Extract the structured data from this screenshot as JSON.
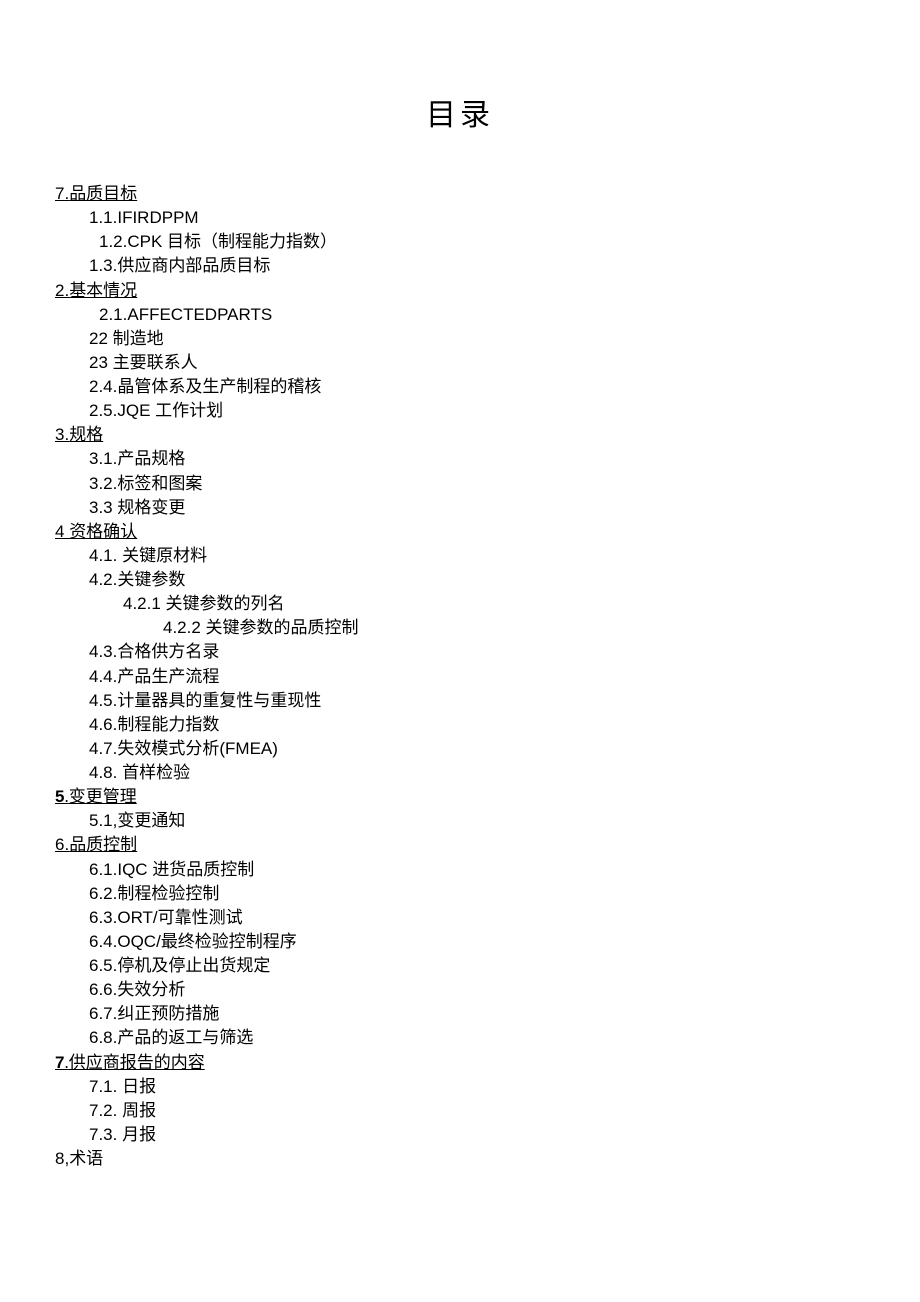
{
  "title": "目录",
  "items": [
    {
      "cls": "l1",
      "spans": [
        {
          "t": "7.",
          "c": "num ul"
        },
        {
          "t": "品质目标",
          "c": "zh-ital ul"
        }
      ]
    },
    {
      "cls": "l2",
      "spans": [
        {
          "t": "1.1.IFIRDPPM",
          "c": "num"
        }
      ]
    },
    {
      "cls": "l2b",
      "spans": [
        {
          "t": "1.2.CPK ",
          "c": "num"
        },
        {
          "t": "目标（制程能力指数）",
          "c": "zh"
        }
      ]
    },
    {
      "cls": "l2",
      "spans": [
        {
          "t": "1.3.",
          "c": "num"
        },
        {
          "t": "供应商内部品质目标",
          "c": "zh"
        }
      ]
    },
    {
      "cls": "l1",
      "spans": [
        {
          "t": "2.",
          "c": "num ul"
        },
        {
          "t": "基本情况",
          "c": "zh-ital ul"
        }
      ]
    },
    {
      "cls": "l2b",
      "spans": [
        {
          "t": "2.1.AFFECTEDPARTS",
          "c": "num"
        }
      ]
    },
    {
      "cls": "l2",
      "spans": [
        {
          "t": "22 ",
          "c": "num"
        },
        {
          "t": "制造地",
          "c": "zh"
        }
      ]
    },
    {
      "cls": "l2",
      "spans": [
        {
          "t": "23 ",
          "c": "num"
        },
        {
          "t": "主要联系人",
          "c": "zh"
        }
      ]
    },
    {
      "cls": "l2",
      "spans": [
        {
          "t": "2.4.",
          "c": "num"
        },
        {
          "t": "晶管体系及生产制程的稽核",
          "c": "zh"
        }
      ]
    },
    {
      "cls": "l2",
      "spans": [
        {
          "t": "2.5.JQE ",
          "c": "num"
        },
        {
          "t": "工作计划",
          "c": "zh"
        }
      ]
    },
    {
      "cls": "l1",
      "spans": [
        {
          "t": "3.",
          "c": "num ul"
        },
        {
          "t": "规格",
          "c": "zh-ital ul"
        }
      ]
    },
    {
      "cls": "l2",
      "spans": [
        {
          "t": "3.1.",
          "c": "num"
        },
        {
          "t": "产品规格",
          "c": "zh"
        }
      ]
    },
    {
      "cls": "l2",
      "spans": [
        {
          "t": "3.2.",
          "c": "num"
        },
        {
          "t": "标签和图案",
          "c": "zh"
        }
      ]
    },
    {
      "cls": "l2",
      "spans": [
        {
          "t": "3.3 ",
          "c": "num"
        },
        {
          "t": "规格变更",
          "c": "zh"
        }
      ]
    },
    {
      "cls": "l1",
      "spans": [
        {
          "t": "4 ",
          "c": "num ul"
        },
        {
          "t": "资格确认",
          "c": "zh-ital ul"
        }
      ]
    },
    {
      "cls": "l2",
      "spans": [
        {
          "t": "4.1. ",
          "c": "num"
        },
        {
          "t": "关键原材料",
          "c": "zh"
        }
      ]
    },
    {
      "cls": "l2",
      "spans": [
        {
          "t": "4.2.",
          "c": "num"
        },
        {
          "t": "关键参数",
          "c": "zh"
        }
      ]
    },
    {
      "cls": "l3",
      "spans": [
        {
          "t": "4.2.1 ",
          "c": "num"
        },
        {
          "t": "关键参数的列名",
          "c": "zh"
        }
      ]
    },
    {
      "cls": "l4",
      "spans": [
        {
          "t": "4.2.2 ",
          "c": "num"
        },
        {
          "t": "关键参数的品质控制",
          "c": "zh"
        }
      ]
    },
    {
      "cls": "l2",
      "spans": [
        {
          "t": "4.3.",
          "c": "num"
        },
        {
          "t": "合格供方名录",
          "c": "zh"
        }
      ]
    },
    {
      "cls": "l2",
      "spans": [
        {
          "t": "4.4.",
          "c": "num"
        },
        {
          "t": "产品生产流程",
          "c": "zh"
        }
      ]
    },
    {
      "cls": "l2",
      "spans": [
        {
          "t": "4.5.",
          "c": "num"
        },
        {
          "t": "计量器具的重复性与重现性",
          "c": "zh"
        }
      ]
    },
    {
      "cls": "l2",
      "spans": [
        {
          "t": "4.6.",
          "c": "num"
        },
        {
          "t": "制程能力指数",
          "c": "zh"
        }
      ]
    },
    {
      "cls": "l2",
      "spans": [
        {
          "t": "4.7.",
          "c": "num"
        },
        {
          "t": "失效模式分析",
          "c": "zh"
        },
        {
          "t": "(FMEA)",
          "c": "num"
        }
      ]
    },
    {
      "cls": "l2",
      "spans": [
        {
          "t": "4.8. ",
          "c": "num"
        },
        {
          "t": "首样检验",
          "c": "zh"
        }
      ]
    },
    {
      "cls": "l1",
      "spans": [
        {
          "t": "5",
          "c": "num bold ul"
        },
        {
          "t": ".",
          "c": "zh-ital ul"
        },
        {
          "t": "变更管理",
          "c": "zh-ital ul"
        }
      ]
    },
    {
      "cls": "l2",
      "spans": [
        {
          "t": "5.1,",
          "c": "num"
        },
        {
          "t": "变更通知",
          "c": "zh"
        }
      ]
    },
    {
      "cls": "l1",
      "spans": [
        {
          "t": "6.",
          "c": "num ul"
        },
        {
          "t": "品质控制",
          "c": "zh-ital ul"
        }
      ]
    },
    {
      "cls": "l2",
      "spans": [
        {
          "t": "6.1.IQC ",
          "c": "num"
        },
        {
          "t": "进货品质控制",
          "c": "zh"
        }
      ]
    },
    {
      "cls": "l2",
      "spans": [
        {
          "t": "6.2.",
          "c": "num"
        },
        {
          "t": "制程检验控制",
          "c": "zh"
        }
      ]
    },
    {
      "cls": "l2",
      "spans": [
        {
          "t": "6.3.ORT/",
          "c": "num"
        },
        {
          "t": "可靠性测试",
          "c": "zh"
        }
      ]
    },
    {
      "cls": "l2",
      "spans": [
        {
          "t": "6.4.OQC/",
          "c": "num"
        },
        {
          "t": "最终检验控制程序",
          "c": "zh"
        }
      ]
    },
    {
      "cls": "l2",
      "spans": [
        {
          "t": "6.5.",
          "c": "num"
        },
        {
          "t": "停机及停止出货规定",
          "c": "zh"
        }
      ]
    },
    {
      "cls": "l2",
      "spans": [
        {
          "t": "6.6.",
          "c": "num"
        },
        {
          "t": "失效分析",
          "c": "zh"
        }
      ]
    },
    {
      "cls": "l2",
      "spans": [
        {
          "t": "6.7.",
          "c": "num"
        },
        {
          "t": "纠正预防措施",
          "c": "zh"
        }
      ]
    },
    {
      "cls": "l2",
      "spans": [
        {
          "t": "6.8.",
          "c": "num"
        },
        {
          "t": "产品的返工与筛选",
          "c": "zh"
        }
      ]
    },
    {
      "cls": "l1",
      "spans": [
        {
          "t": "7",
          "c": "num bold ul"
        },
        {
          "t": ".",
          "c": "zh-ital ul"
        },
        {
          "t": "供应商报告的内容",
          "c": "zh-ital ul"
        }
      ]
    },
    {
      "cls": "l2",
      "spans": [
        {
          "t": "7.1. ",
          "c": "num"
        },
        {
          "t": "日报",
          "c": "zh"
        }
      ]
    },
    {
      "cls": "l2",
      "spans": [
        {
          "t": "7.2. ",
          "c": "num"
        },
        {
          "t": "周报",
          "c": "zh"
        }
      ]
    },
    {
      "cls": "l2",
      "spans": [
        {
          "t": "7.3. ",
          "c": "num"
        },
        {
          "t": "月报",
          "c": "zh"
        }
      ]
    },
    {
      "cls": "l1",
      "spans": [
        {
          "t": "8,",
          "c": "num"
        },
        {
          "t": "术语",
          "c": "zh-ital"
        }
      ]
    }
  ]
}
